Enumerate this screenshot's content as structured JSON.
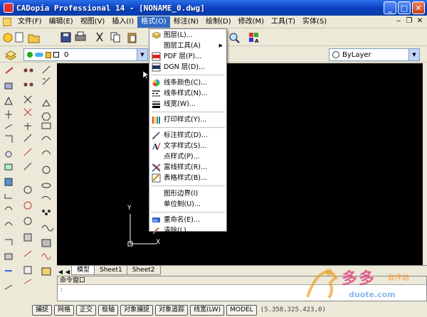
{
  "window": {
    "title": "CADopia Professional 14 - [NONAME_0.dwg]"
  },
  "menubar": {
    "items": [
      "文件(F)",
      "编辑(E)",
      "视图(V)",
      "插入(I)",
      "格式(O)",
      "标注(N)",
      "绘制(D)",
      "修改(M)",
      "工具(T)",
      "实体(S)"
    ],
    "active_index": 4
  },
  "toolbar": {
    "layer_value": "0",
    "linetype_value": "ByLayer"
  },
  "format_menu": {
    "items": [
      {
        "label": "图层(L)...",
        "icon": "layers-icon"
      },
      {
        "label": "图层工具(A)",
        "icon": "none",
        "submenu": true
      },
      {
        "label": "PDF 层(P)...",
        "icon": "pdf-icon"
      },
      {
        "label": "DGN 层(D)...",
        "icon": "dgn-icon"
      },
      {
        "sep": true
      },
      {
        "label": "线条颜色(C)...",
        "icon": "color-wheel-icon"
      },
      {
        "label": "线条样式(N)...",
        "icon": "linetype-icon"
      },
      {
        "label": "线宽(W)...",
        "icon": "lineweight-icon"
      },
      {
        "sep": true
      },
      {
        "label": "打印样式(Y)...",
        "icon": "plot-style-icon"
      },
      {
        "sep": true
      },
      {
        "label": "标注样式(D)...",
        "icon": "dimension-style-icon"
      },
      {
        "label": "文字样式(S)...",
        "icon": "text-style-icon"
      },
      {
        "label": "点样式(P)...",
        "icon": "none"
      },
      {
        "label": "富线样式(R)...",
        "icon": "mline-style-icon"
      },
      {
        "label": "表格样式(B)...",
        "icon": "table-style-icon"
      },
      {
        "sep": true
      },
      {
        "label": "图形边界(I)",
        "icon": "none"
      },
      {
        "label": "单位制(U)...",
        "icon": "none"
      },
      {
        "sep": true
      },
      {
        "label": "重命名(E)...",
        "icon": "rename-icon"
      },
      {
        "label": "清除(L)...",
        "icon": "purge-icon"
      }
    ]
  },
  "ucs": {
    "x_label": "X",
    "y_label": "Y"
  },
  "tabs": [
    "模型",
    "Sheet1",
    "Sheet2"
  ],
  "command_window": {
    "title": "命令窗口",
    "prompt": ":"
  },
  "statusbar": {
    "buttons": [
      "捕捉",
      "网格",
      "正交",
      "极轴",
      "对象捕捉",
      "对象追踪",
      "线宽(LW)",
      "MODEL"
    ],
    "coords": "(5.358,325.423,0)"
  },
  "watermark": {
    "text": "多多",
    "sub": "软件站",
    "url": "duote.com"
  },
  "colors": {
    "title_blue": "#0a3fbf",
    "menu_highlight": "#316ac5",
    "canvas": "#000000"
  }
}
